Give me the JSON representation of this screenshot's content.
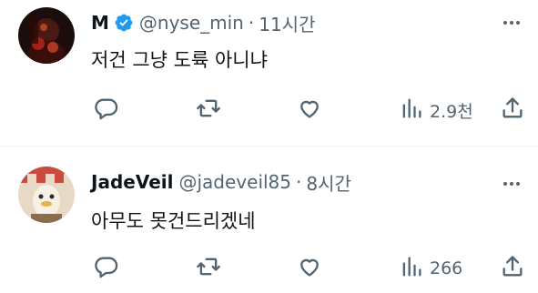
{
  "tweets": [
    {
      "name": "M",
      "verified": true,
      "handle": "@nyse_min",
      "separator": "·",
      "time": "11시간",
      "text": "저건 그냥 도륙 아니냐",
      "views": "2.9천"
    },
    {
      "name": "JadeVeil",
      "verified": false,
      "handle": "@jadeveil85",
      "separator": "·",
      "time": "8시간",
      "text": "아무도 못건드리겠네",
      "views": "266"
    }
  ],
  "colors": {
    "text": "#0f1419",
    "secondary": "#536471",
    "verified": "#1d9bf0",
    "divider": "#eff3f4"
  },
  "icons": [
    "reply-icon",
    "retweet-icon",
    "like-icon",
    "views-icon",
    "share-icon",
    "more-icon",
    "verified-badge-icon"
  ]
}
